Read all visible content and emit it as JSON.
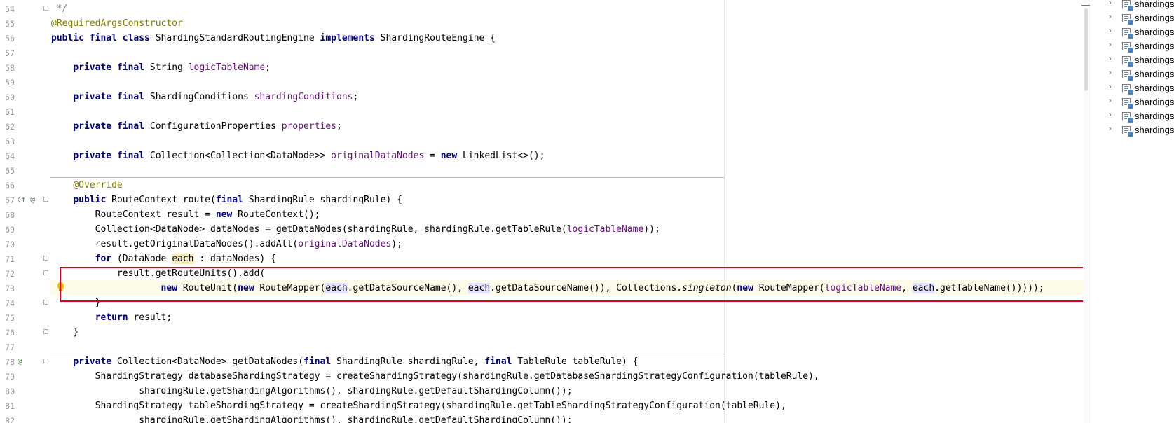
{
  "editor": {
    "lines": [
      {
        "no": "54",
        "fold": true,
        "tokens": [
          {
            "t": " */",
            "c": "cmt"
          }
        ]
      },
      {
        "no": "55",
        "tokens": [
          {
            "t": "@RequiredArgsConstructor",
            "c": "ann"
          }
        ]
      },
      {
        "no": "56",
        "tokens": [
          {
            "t": "public final class",
            "c": "kw"
          },
          {
            "t": " ShardingStandardRoutingEngine "
          },
          {
            "t": "implements",
            "c": "kw"
          },
          {
            "t": " ShardingRouteEngine {"
          }
        ]
      },
      {
        "no": "57",
        "tokens": []
      },
      {
        "no": "58",
        "tokens": [
          {
            "t": "    "
          },
          {
            "t": "private final",
            "c": "kw"
          },
          {
            "t": " String "
          },
          {
            "t": "logicTableName",
            "c": "fld"
          },
          {
            "t": ";"
          }
        ]
      },
      {
        "no": "59",
        "tokens": []
      },
      {
        "no": "60",
        "tokens": [
          {
            "t": "    "
          },
          {
            "t": "private final",
            "c": "kw"
          },
          {
            "t": " ShardingConditions "
          },
          {
            "t": "shardingConditions",
            "c": "fld"
          },
          {
            "t": ";"
          }
        ]
      },
      {
        "no": "61",
        "tokens": []
      },
      {
        "no": "62",
        "tokens": [
          {
            "t": "    "
          },
          {
            "t": "private final",
            "c": "kw"
          },
          {
            "t": " ConfigurationProperties "
          },
          {
            "t": "properties",
            "c": "fld"
          },
          {
            "t": ";"
          }
        ]
      },
      {
        "no": "63",
        "tokens": []
      },
      {
        "no": "64",
        "tokens": [
          {
            "t": "    "
          },
          {
            "t": "private final",
            "c": "kw"
          },
          {
            "t": " Collection<Collection<DataNode>> "
          },
          {
            "t": "originalDataNodes",
            "c": "fld"
          },
          {
            "t": " = "
          },
          {
            "t": "new",
            "c": "kw"
          },
          {
            "t": " LinkedList<>();"
          }
        ]
      },
      {
        "no": "65",
        "tokens": []
      },
      {
        "no": "66",
        "tokens": [
          {
            "t": "    "
          },
          {
            "t": "@Override",
            "c": "ann"
          }
        ]
      },
      {
        "no": "67",
        "icons": "⬨↑ @",
        "fold": true,
        "tokens": [
          {
            "t": "    "
          },
          {
            "t": "public",
            "c": "kw"
          },
          {
            "t": " RouteContext route("
          },
          {
            "t": "final",
            "c": "kw"
          },
          {
            "t": " ShardingRule shardingRule) {"
          }
        ]
      },
      {
        "no": "68",
        "tokens": [
          {
            "t": "        RouteContext result = "
          },
          {
            "t": "new",
            "c": "kw"
          },
          {
            "t": " RouteContext();"
          }
        ]
      },
      {
        "no": "69",
        "tokens": [
          {
            "t": "        Collection<DataNode> dataNodes = getDataNodes(shardingRule, shardingRule.getTableRule("
          },
          {
            "t": "logicTableName",
            "c": "fld"
          },
          {
            "t": "));"
          }
        ]
      },
      {
        "no": "70",
        "tokens": [
          {
            "t": "        result.getOriginalDataNodes().addAll("
          },
          {
            "t": "originalDataNodes",
            "c": "fld"
          },
          {
            "t": ");"
          }
        ]
      },
      {
        "no": "71",
        "fold": true,
        "tokens": [
          {
            "t": "        "
          },
          {
            "t": "for",
            "c": "kw"
          },
          {
            "t": " (DataNode "
          },
          {
            "t": "each",
            "c": "hlw"
          },
          {
            "t": " : dataNodes) {"
          }
        ]
      },
      {
        "no": "72",
        "fold": true,
        "tokens": [
          {
            "t": "            result.getRouteUnits().add("
          }
        ]
      },
      {
        "no": "73",
        "tokens": [
          {
            "t": "                    "
          },
          {
            "t": "new",
            "c": "kw"
          },
          {
            "t": " RouteUnit("
          },
          {
            "t": "new",
            "c": "kw"
          },
          {
            "t": " RouteMapper("
          },
          {
            "t": "each",
            "c": "hl"
          },
          {
            "t": ".getDataSourceName(), "
          },
          {
            "t": "each",
            "c": "hl"
          },
          {
            "t": ".getDataSourceName()), Collections."
          },
          {
            "t": "singleton",
            "c": "it"
          },
          {
            "t": "("
          },
          {
            "t": "new",
            "c": "kw"
          },
          {
            "t": " RouteMapper("
          },
          {
            "t": "logicTableName",
            "c": "fld"
          },
          {
            "t": ", "
          },
          {
            "t": "each",
            "c": "hl"
          },
          {
            "t": ".getTableName()))));"
          }
        ]
      },
      {
        "no": "74",
        "fold": true,
        "tokens": [
          {
            "t": "        }"
          }
        ]
      },
      {
        "no": "75",
        "tokens": [
          {
            "t": "        "
          },
          {
            "t": "return",
            "c": "kw"
          },
          {
            "t": " result;"
          }
        ]
      },
      {
        "no": "76",
        "fold": true,
        "tokens": [
          {
            "t": "    }"
          }
        ]
      },
      {
        "no": "77",
        "tokens": []
      },
      {
        "no": "78",
        "icons": "  @",
        "fold": true,
        "tokens": [
          {
            "t": "    "
          },
          {
            "t": "private",
            "c": "kw"
          },
          {
            "t": " Collection<DataNode> getDataNodes("
          },
          {
            "t": "final",
            "c": "kw"
          },
          {
            "t": " ShardingRule shardingRule, "
          },
          {
            "t": "final",
            "c": "kw"
          },
          {
            "t": " TableRule tableRule) {"
          }
        ]
      },
      {
        "no": "79",
        "tokens": [
          {
            "t": "        ShardingStrategy databaseShardingStrategy = createShardingStrategy(shardingRule.getDatabaseShardingStrategyConfiguration(tableRule),"
          }
        ]
      },
      {
        "no": "80",
        "tokens": [
          {
            "t": "                shardingRule.getShardingAlgorithms(), shardingRule.getDefaultShardingColumn());"
          }
        ]
      },
      {
        "no": "81",
        "tokens": [
          {
            "t": "        ShardingStrategy tableShardingStrategy = createShardingStrategy(shardingRule.getTableShardingStrategyConfiguration(tableRule),"
          }
        ]
      },
      {
        "no": "82",
        "tokens": [
          {
            "t": "                shardingRule.getShardingAlgorithms(), shardingRule.getDefaultShardingColumn());"
          }
        ]
      }
    ]
  },
  "project_tree": {
    "items": [
      {
        "label": "shardings"
      },
      {
        "label": "shardings"
      },
      {
        "label": "shardings"
      },
      {
        "label": "shardings"
      },
      {
        "label": "shardings"
      },
      {
        "label": "shardings"
      },
      {
        "label": "shardings"
      },
      {
        "label": "shardings"
      },
      {
        "label": "shardings"
      },
      {
        "label": "shardings"
      }
    ]
  },
  "colors": {
    "keyword": "#000080",
    "annotation": "#808000",
    "field": "#660e7a",
    "comment": "#808080",
    "highlight_box": "#e0001b",
    "current_line": "#fcfae8"
  },
  "icons": {
    "gutter": [
      "implementation-icon",
      "override-icon"
    ],
    "tree": [
      "chevron-right-icon",
      "module-icon"
    ],
    "editor": [
      "intention-bulb-icon"
    ]
  }
}
